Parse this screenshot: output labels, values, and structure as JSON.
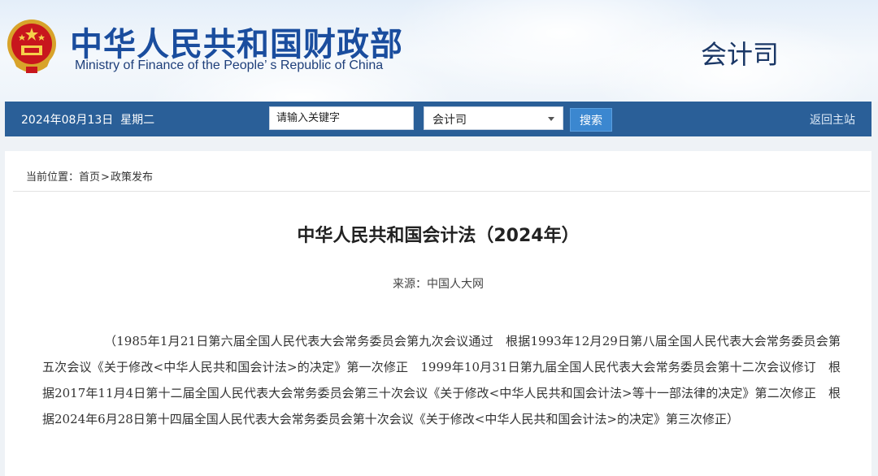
{
  "header": {
    "title_cn": "中华人民共和国财政部",
    "title_en": "Ministry of Finance of the People’ s Republic of China",
    "department": "会计司",
    "emblem": "national-emblem-icon"
  },
  "navbar": {
    "date": "2024年08月13日",
    "weekday": "星期二",
    "search_placeholder": "请输入关键字",
    "select_value": "会计司",
    "search_button": "搜索",
    "home_link": "返回主站"
  },
  "breadcrumb": {
    "label": "当前位置：",
    "home": "首页",
    "separator": ">",
    "section": "政策发布"
  },
  "article": {
    "title": "中华人民共和国会计法（2024年）",
    "source": "来源：中国人大网",
    "preamble": "（1985年1月21日第六届全国人民代表大会常务委员会第九次会议通过　根据1993年12月29日第八届全国人民代表大会常务委员会第五次会议《关于修改<中华人民共和国会计法>的决定》第一次修正　1999年10月31日第九届全国人民代表大会常务委员会第十二次会议修订　根据2017年11月4日第十二届全国人民代表大会常务委员会第三十次会议《关于修改<中华人民共和国会计法>等十一部法律的决定》第二次修正　根据2024年6月28日第十四届全国人民代表大会常务委员会第十次会议《关于修改<中华人民共和国会计法>的决定》第三次修正）"
  },
  "colors": {
    "navbar_bg": "#2a5f98",
    "title_blue": "#1a4d9e",
    "button_blue": "#3b87d0"
  }
}
